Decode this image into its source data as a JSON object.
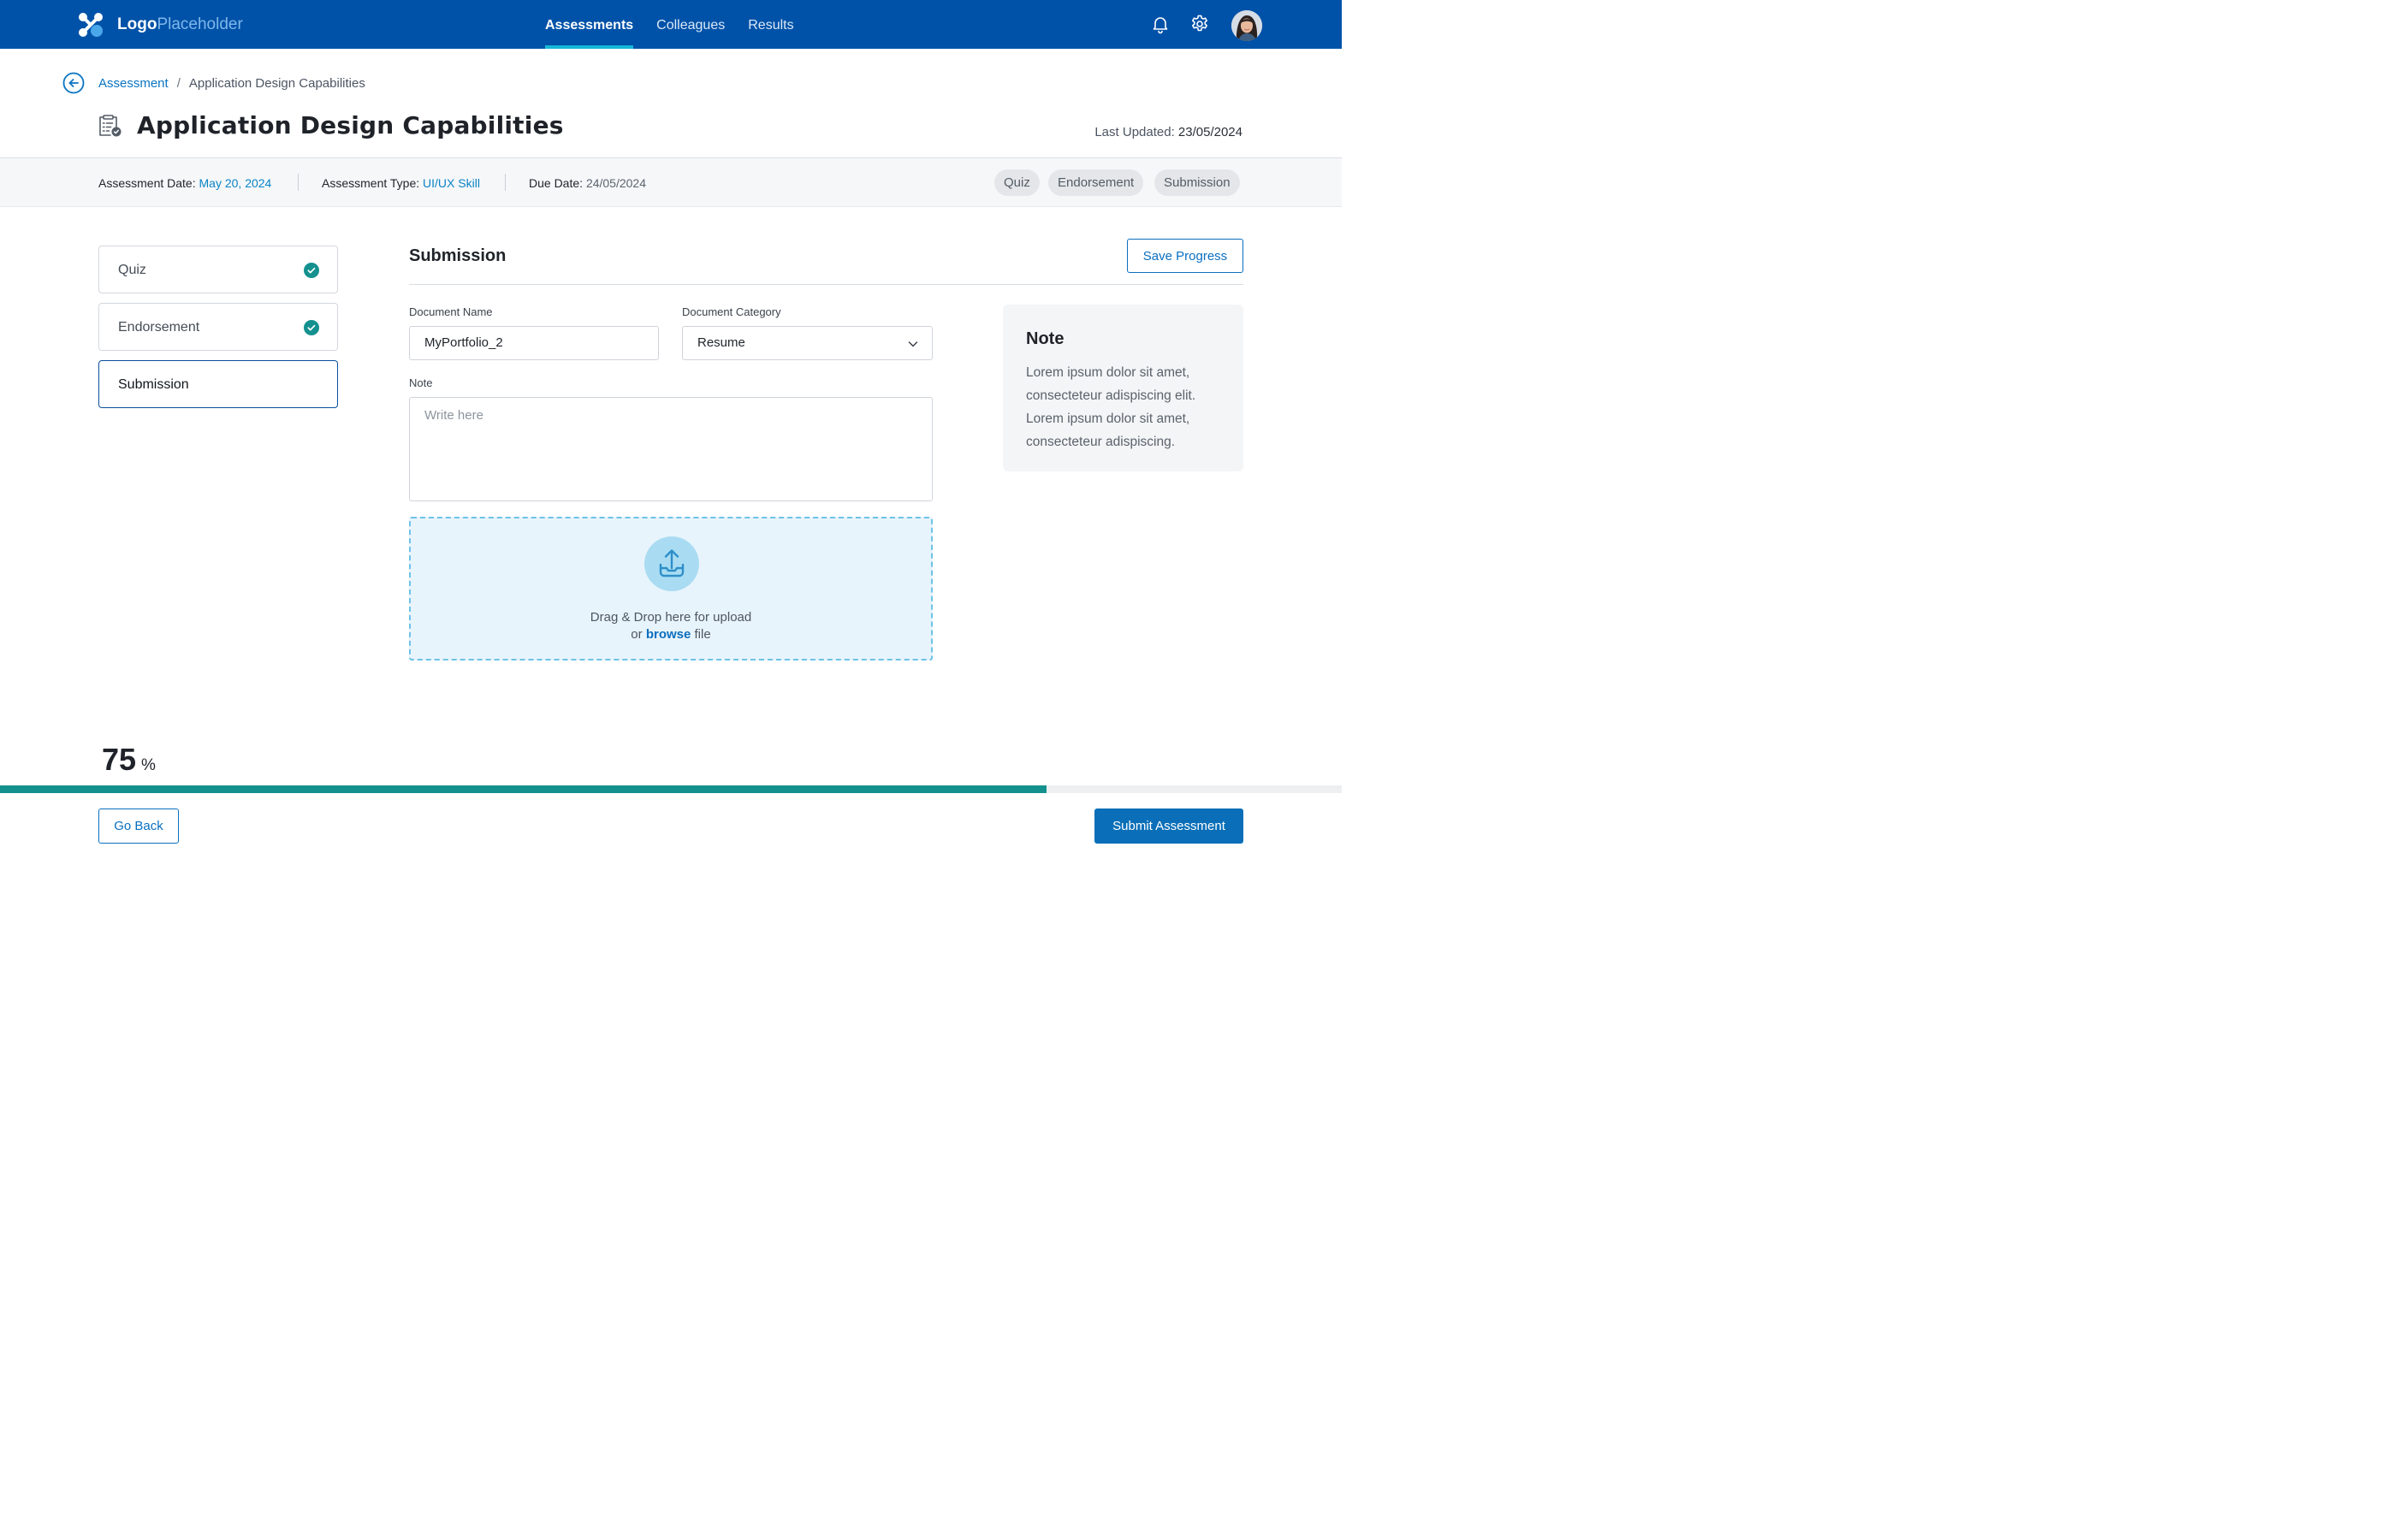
{
  "nav": {
    "logo_bold": "Logo",
    "logo_light": "Placeholder",
    "links": [
      {
        "label": "Assessments",
        "active": true
      },
      {
        "label": "Colleagues",
        "active": false
      },
      {
        "label": "Results",
        "active": false
      }
    ],
    "icons": [
      "bell-icon",
      "gear-icon",
      "avatar"
    ]
  },
  "breadcrumb": {
    "parent": "Assessment",
    "separator": "/",
    "current": "Application Design Capabilities"
  },
  "header": {
    "title": "Application Design Capabilities",
    "last_updated_label": "Last Updated:",
    "last_updated_value": "23/05/2024"
  },
  "info": {
    "assessment_date_label": "Assessment Date:",
    "assessment_date_value": "May 20, 2024",
    "assessment_type_label": "Assessment Type:",
    "assessment_type_value": "UI/UX Skill",
    "due_date_label": "Due Date:",
    "due_date_value": "24/05/2024",
    "chips": [
      "Quiz",
      "Endorsement",
      "Submission"
    ]
  },
  "steps": [
    {
      "label": "Quiz",
      "completed": true,
      "active": false
    },
    {
      "label": "Endorsement",
      "completed": true,
      "active": false
    },
    {
      "label": "Submission",
      "completed": false,
      "active": true
    }
  ],
  "form": {
    "section_title": "Submission",
    "save_label": "Save Progress",
    "doc_name_label": "Document Name",
    "doc_name_value": "MyPortfolio_2",
    "doc_category_label": "Document Category",
    "doc_category_value": "Resume",
    "note_label": "Note",
    "note_placeholder": "Write here",
    "dropzone_line1": "Drag & Drop here for upload",
    "dropzone_or": "or",
    "dropzone_browse": "browse",
    "dropzone_file": "file"
  },
  "note_panel": {
    "title": "Note",
    "body": "Lorem ipsum dolor sit amet, consecteteur adispiscing elit. Lorem ipsum dolor sit amet, consecteteur adispiscing."
  },
  "progress": {
    "value": "75",
    "unit": "%",
    "fraction": 0.78
  },
  "footer": {
    "go_back_label": "Go Back",
    "submit_label": "Submit Assessment"
  },
  "colors": {
    "nav_bg": "#0052a8",
    "accent_blue": "#0a6fbf",
    "teal": "#14918f",
    "dropzone_bg": "#e8f4fc"
  }
}
